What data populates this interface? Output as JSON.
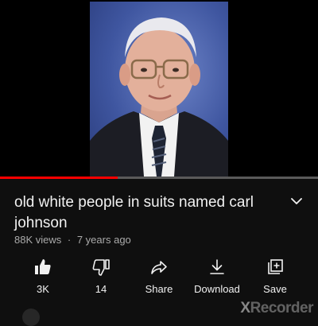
{
  "video": {
    "progress_fraction": 0.37,
    "progress_color": "#ff0000"
  },
  "details": {
    "title": "old white people in suits named carl johnson",
    "views": "88K views",
    "separator": "·",
    "age": "7 years ago"
  },
  "actions": [
    {
      "icon": "thumbs-up-filled-icon",
      "label": "3K"
    },
    {
      "icon": "thumbs-down-icon",
      "label": "14"
    },
    {
      "icon": "share-arrow-icon",
      "label": "Share"
    },
    {
      "icon": "download-icon",
      "label": "Download"
    },
    {
      "icon": "save-playlist-icon",
      "label": "Save"
    }
  ],
  "watermark": {
    "first_letter": "X",
    "rest": "Recorder"
  }
}
